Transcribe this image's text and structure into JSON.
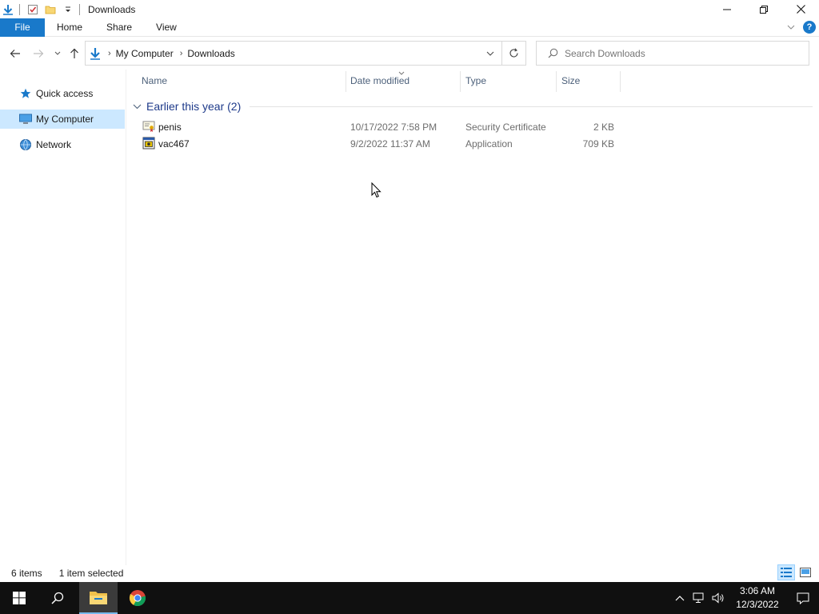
{
  "window": {
    "title": "Downloads"
  },
  "ribbon": {
    "tabs": [
      "File",
      "Home",
      "Share",
      "View"
    ]
  },
  "address": {
    "crumbs": [
      "My Computer",
      "Downloads"
    ]
  },
  "search": {
    "placeholder": "Search Downloads"
  },
  "nav_pane": {
    "items": [
      {
        "label": "Quick access",
        "icon": "star-icon",
        "selected": false
      },
      {
        "label": "My Computer",
        "icon": "computer-icon",
        "selected": true
      },
      {
        "label": "Network",
        "icon": "network-icon",
        "selected": false
      }
    ]
  },
  "columns": [
    "Name",
    "Date modified",
    "Type",
    "Size"
  ],
  "group": {
    "title": "Earlier this year (2)"
  },
  "files": [
    {
      "name": "penis",
      "date": "10/17/2022 7:58 PM",
      "type": "Security Certificate",
      "size": "2 KB",
      "icon": "certificate-icon"
    },
    {
      "name": "vac467",
      "date": "9/2/2022 11:37 AM",
      "type": "Application",
      "size": "709 KB",
      "icon": "application-icon"
    }
  ],
  "status": {
    "items": "6 items",
    "selected": "1 item selected"
  },
  "taskbar": {
    "time": "3:06 AM",
    "date": "12/3/2022"
  },
  "colors": {
    "accent": "#1979ca",
    "selection": "#cce8ff",
    "group_text": "#1e3a8a",
    "taskbar": "#101010"
  }
}
